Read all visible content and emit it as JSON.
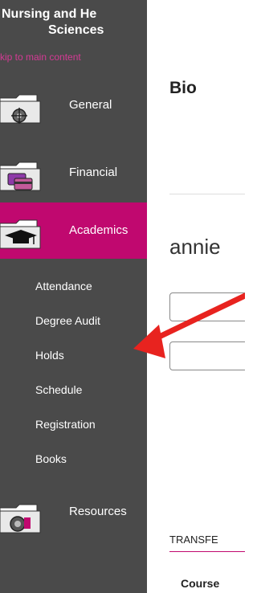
{
  "site": {
    "title_line1": "Nursing and He",
    "title_line2": "Sciences",
    "skip_link": "kip to main content"
  },
  "sidebar": {
    "items": [
      {
        "label": "General",
        "icon": "gear-folder-icon"
      },
      {
        "label": "Financial",
        "icon": "credit-card-folder-icon"
      },
      {
        "label": "Academics",
        "icon": "graduation-cap-folder-icon",
        "active": true
      },
      {
        "label": "Resources",
        "icon": "resources-folder-icon"
      }
    ],
    "sub_items": [
      {
        "label": "Attendance"
      },
      {
        "label": "Degree Audit"
      },
      {
        "label": "Holds"
      },
      {
        "label": "Schedule"
      },
      {
        "label": "Registration"
      },
      {
        "label": "Books"
      }
    ]
  },
  "main": {
    "title": "Bio",
    "student_name": "annie",
    "transfer_label": "TRANSFE",
    "course_header": "Course"
  },
  "colors": {
    "sidebar_bg": "#4a4a4a",
    "active_bg": "#c0086f",
    "skip_link": "#d53a95",
    "annotation_arrow": "#e8231f"
  }
}
